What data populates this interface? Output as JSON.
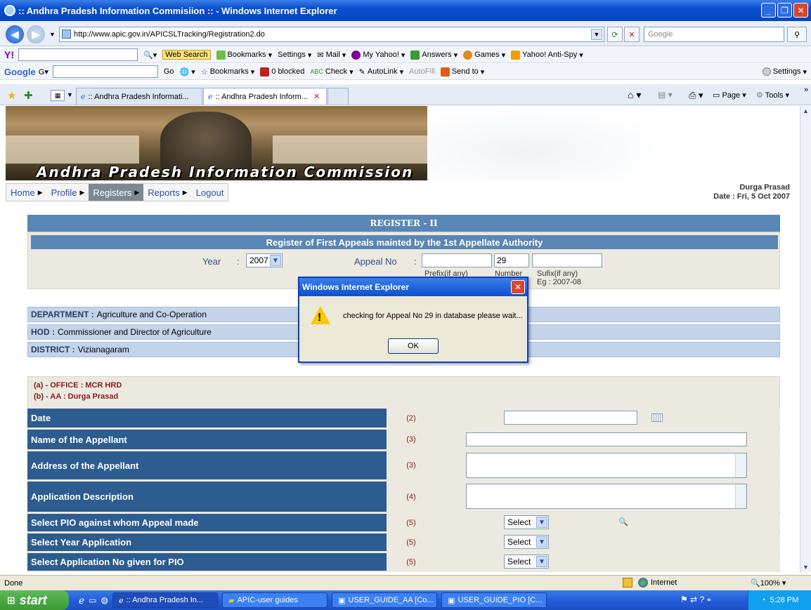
{
  "window": {
    "title": ":: Andhra Pradesh Information Commisiion :: - Windows Internet Explorer"
  },
  "address": {
    "url": "http://www.apic.gov.in/APICSLTracking/Registration2.do",
    "search_placeholder": "Google"
  },
  "yahoo_toolbar": {
    "search_label": "Web Search",
    "items": [
      "Bookmarks",
      "Settings",
      "Mail",
      "My Yahoo!",
      "Answers",
      "Games",
      "Yahoo! Anti-Spy"
    ]
  },
  "google_toolbar": {
    "brand": "Google",
    "items": [
      "Go",
      "Bookmarks",
      "0 blocked",
      "Check",
      "AutoLink",
      "AutoFill",
      "Send to"
    ],
    "settings": "Settings"
  },
  "tabs": [
    {
      "label": ":: Andhra Pradesh Informati..."
    },
    {
      "label": ":: Andhra Pradesh Inform..."
    }
  ],
  "command_bar": {
    "page": "Page",
    "tools": "Tools"
  },
  "site": {
    "banner_title": "Andhra Pradesh Information Commission",
    "menu": [
      "Home",
      "Profile",
      "Registers",
      "Reports",
      "Logout"
    ],
    "active_menu": "Registers",
    "user_name": "Durga Prasad",
    "date_text": "Date : Fri, 5 Oct 2007"
  },
  "register": {
    "heading": "REGISTER - II",
    "subheading": "Register of First Appeals mainted by the 1st Appellate Authority",
    "year_label": "Year",
    "year_value": "2007",
    "appeal_label": "Appeal No",
    "number_value": "29",
    "prefix_note": "Prefix(if any)",
    "number_note": "Number",
    "suffix_note": "Sufix(if any)",
    "example_note": "Eg : 2007-08"
  },
  "info": {
    "department_label": "DEPARTMENT :",
    "department": "Agriculture and Co-Operation",
    "hod_label": "HOD :",
    "hod": "Commissioner and Director of Agriculture",
    "district_label": "DISTRICT :",
    "district": "Vizianagaram"
  },
  "section": {
    "office": "(a) - OFFICE : MCR HRD",
    "aa": "(b) - AA : Durga Prasad"
  },
  "fields": [
    {
      "label": "Date",
      "num": "(2)"
    },
    {
      "label": "Name of the Appellant",
      "num": "(3)"
    },
    {
      "label": "Address of the Appellant",
      "num": "(3)"
    },
    {
      "label": "Application Description",
      "num": "(4)"
    },
    {
      "label": "Select PIO against whom Appeal made",
      "num": "(5)",
      "select": "Select"
    },
    {
      "label": "Select Year Application",
      "num": "(5)",
      "select": "Select"
    },
    {
      "label": "Select Application No given for PIO",
      "num": "(5)",
      "select": "Select"
    }
  ],
  "dialog": {
    "title": "Windows Internet Explorer",
    "message": "checking for Appeal No 29 in database please wait...",
    "ok": "OK"
  },
  "status": {
    "text": "Done",
    "zone": "Internet",
    "zoom": "100%"
  },
  "taskbar": {
    "start": "start",
    "tasks": [
      ":: Andhra Pradesh In...",
      "APIC-user guides",
      "USER_GUIDE_AA [Co...",
      "USER_GUIDE_PIO [C..."
    ],
    "clock": "5:28 PM"
  }
}
